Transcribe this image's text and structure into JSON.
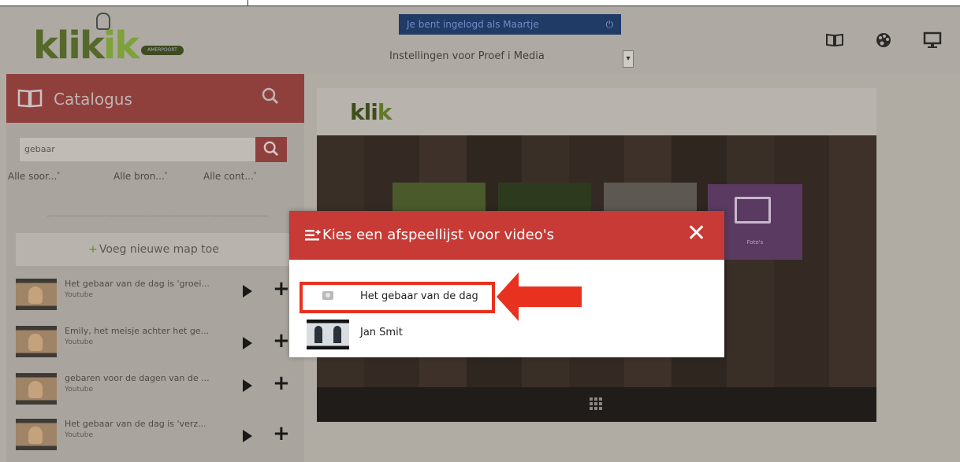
{
  "header": {
    "logo_text_1": "klik",
    "logo_text_2": "ik",
    "logo_pill": "AMERPOORT",
    "login_text": "Je bent ingelogd als Maartje",
    "power_icon": "power-icon",
    "settings_text": "Instellingen voor  Proef i Media",
    "icons": [
      "book-icon",
      "palette-icon",
      "monitor-icon"
    ]
  },
  "sidebar": {
    "title": "Catalogus",
    "search_value": "gebaar",
    "filters": [
      "Alle soor...",
      "Alle bron...",
      "Alle cont..."
    ],
    "add_map_label": "Voeg nieuwe map toe",
    "videos": [
      {
        "title": "Het gebaar van de dag is 'groei...",
        "source": "Youtube"
      },
      {
        "title": "Emily, het meisje achter het ge...",
        "source": "Youtube"
      },
      {
        "title": "gebaren voor de dagen van de ...",
        "source": "Youtube"
      },
      {
        "title": "Het gebaar van de dag is 'verz...",
        "source": "Youtube"
      }
    ]
  },
  "main": {
    "logo_text_1": "kli",
    "logo_text_2": "k",
    "foto_tile_label": "Foto's"
  },
  "modal": {
    "title": "Kies een afspeellijst voor video's",
    "close_label": "✕",
    "playlists": [
      {
        "label": "Het gebaar van de dag"
      },
      {
        "label": "Jan Smit"
      }
    ]
  },
  "colors": {
    "accent_red": "#c73a35",
    "highlight": "#e8311e",
    "brand_green": "#7ea23a"
  }
}
